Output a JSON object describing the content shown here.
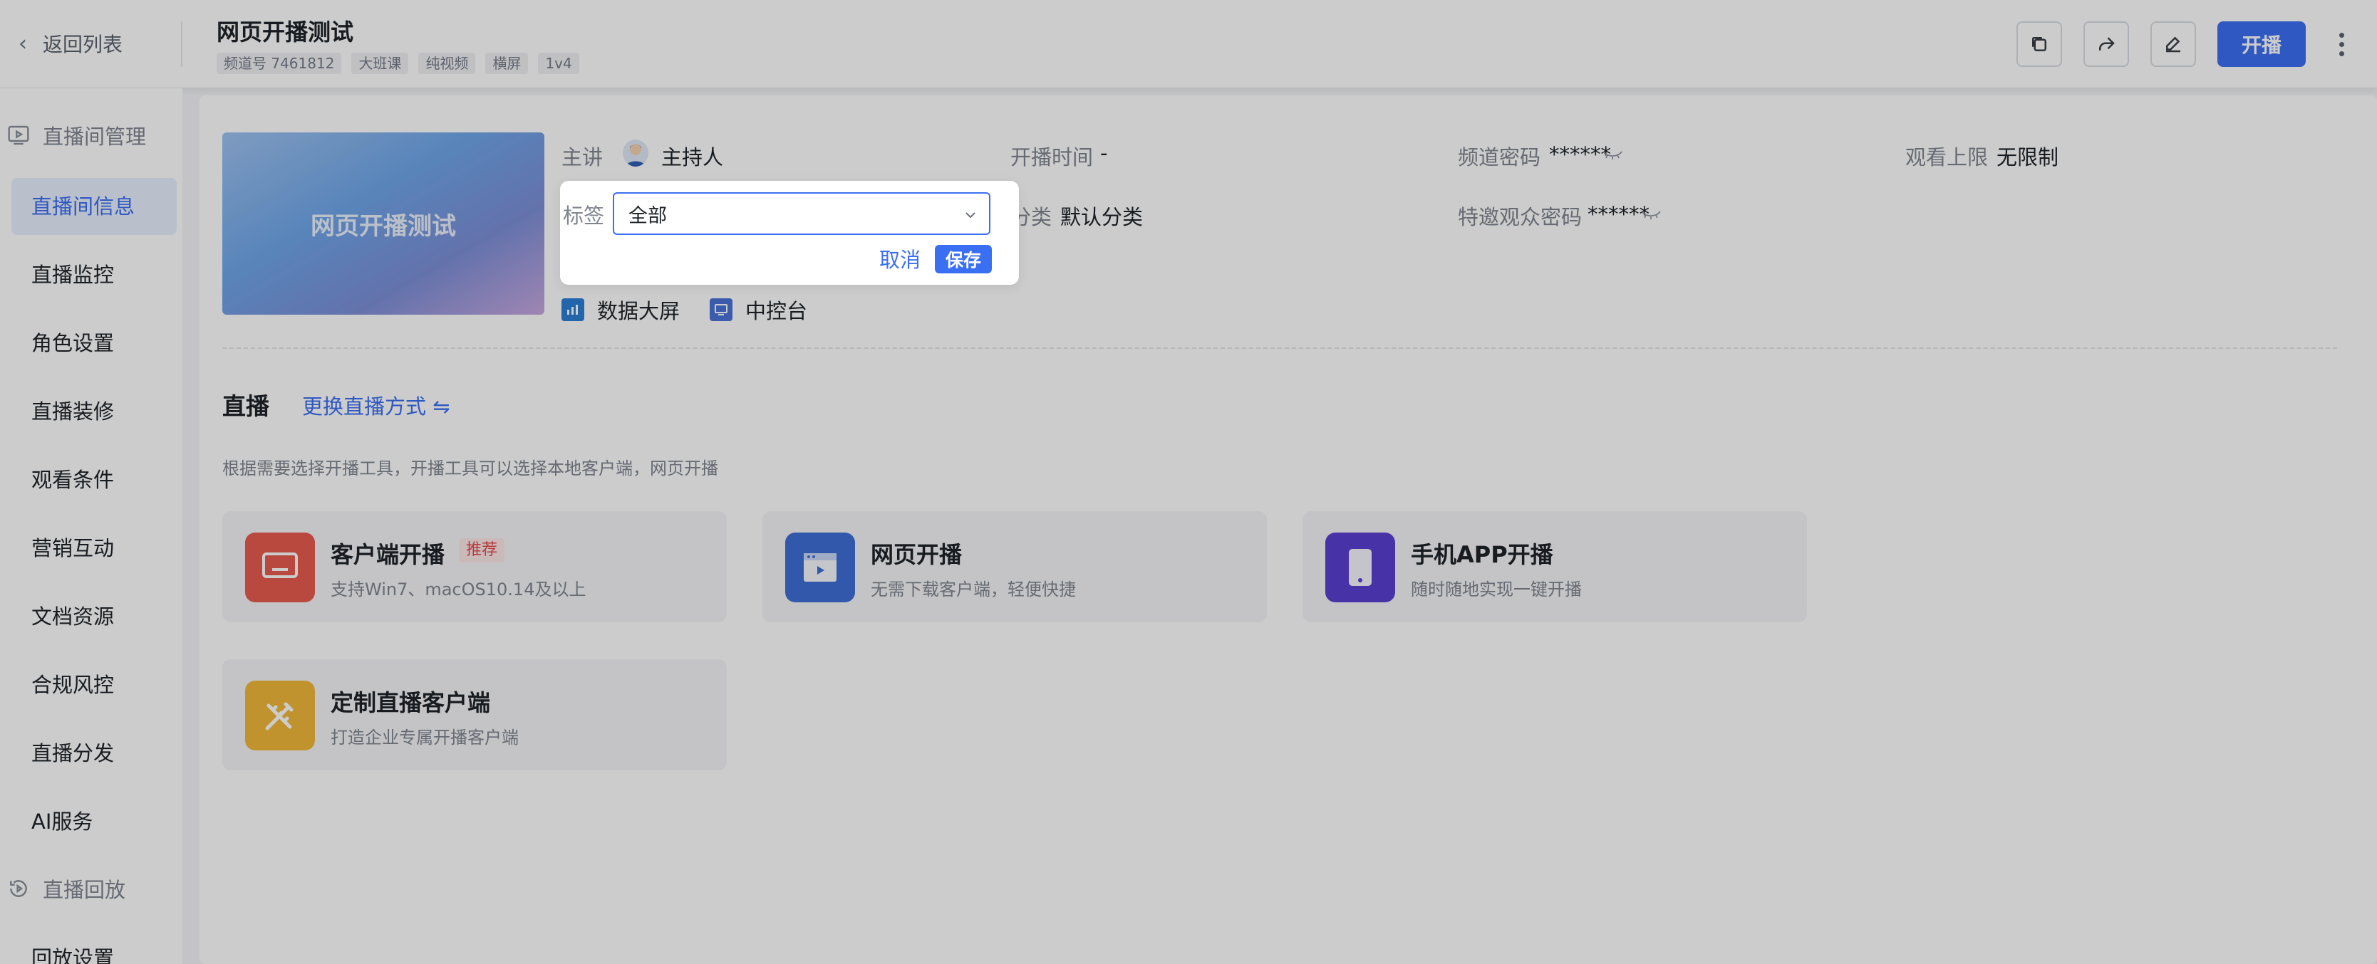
{
  "header": {
    "back_label": "返回列表",
    "title": "网页开播测试",
    "tags": [
      "频道号 7461812",
      "大班课",
      "纯视频",
      "横屏",
      "1v4"
    ],
    "start_label": "开播"
  },
  "sidebar": {
    "group_live": "直播间管理",
    "items": [
      "直播间信息",
      "直播监控",
      "角色设置",
      "直播装修",
      "观看条件",
      "营销互动",
      "文档资源",
      "合规风控",
      "直播分发",
      "AI服务"
    ],
    "group_replay": "直播回放",
    "replay_items": [
      "回放设置"
    ],
    "active_index": 0
  },
  "info": {
    "cover_text": "网页开播测试",
    "host_label": "主讲",
    "host_value": "主持人",
    "start_time_label": "开播时间",
    "start_time_value": "-",
    "channel_pwd_label": "频道密码",
    "channel_pwd_value": "******",
    "view_limit_label": "观看上限",
    "view_limit_value": "无限制",
    "category_label": "分类",
    "category_value": "默认分类",
    "guest_pwd_label": "特邀观众密码",
    "guest_pwd_value": "******",
    "data_screen": "数据大屏",
    "control_panel": "中控台"
  },
  "live": {
    "section_title": "直播",
    "switch_label": "更换直播方式 ⇋",
    "hint": "根据需要选择开播工具，开播工具可以选择本地客户端，网页开播",
    "tools": [
      {
        "name": "客户端开播",
        "desc": "支持Win7、macOS10.14及以上",
        "badge": "推荐"
      },
      {
        "name": "网页开播",
        "desc": "无需下载客户端，轻便快捷"
      },
      {
        "name": "手机APP开播",
        "desc": "随时随地实现一键开播"
      },
      {
        "name": "定制直播客户端",
        "desc": "打造企业专属开播客户端"
      }
    ]
  },
  "popover": {
    "label": "标签",
    "selected": "全部",
    "cancel": "取消",
    "save": "保存"
  },
  "colors": {
    "primary": "#3b6ff3",
    "client_icon": "#e85a4f",
    "web_icon": "#3f6fd8",
    "app_icon": "#5b3fd1",
    "custom_icon": "#f0b83a"
  }
}
